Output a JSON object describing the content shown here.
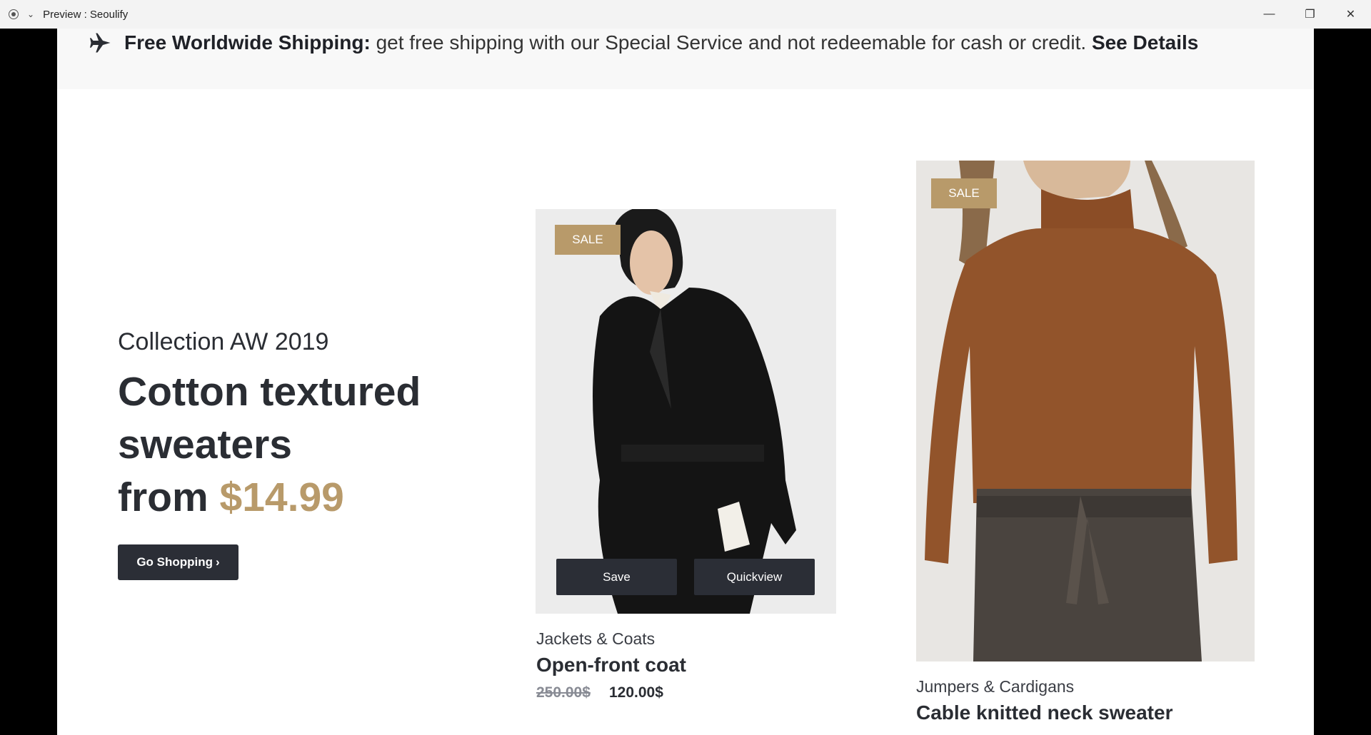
{
  "window": {
    "title": "Preview : Seoulify"
  },
  "promo": {
    "icon": "airplane-icon",
    "lead": "Free Worldwide Shipping:",
    "text": " get free shipping with our Special Service and not redeemable for cash or credit. ",
    "link": "See Details"
  },
  "hero": {
    "eyebrow": "Collection AW 2019",
    "title_line1": "Cotton textured",
    "title_line2": "sweaters",
    "title_prefix": "from ",
    "price": "$14.99",
    "button": "Go Shopping",
    "button_icon": "›"
  },
  "products": [
    {
      "badge": "SALE",
      "category": "Jackets & Coats",
      "name": "Open-front coat",
      "old_price": "250.00$",
      "price": "120.00$",
      "save_label": "Save",
      "quickview_label": "Quickview"
    },
    {
      "badge": "SALE",
      "category": "Jumpers & Cardigans",
      "name": "Cable knitted neck sweater"
    }
  ],
  "colors": {
    "accent": "#b89a6a",
    "dark": "#2b2e36"
  }
}
